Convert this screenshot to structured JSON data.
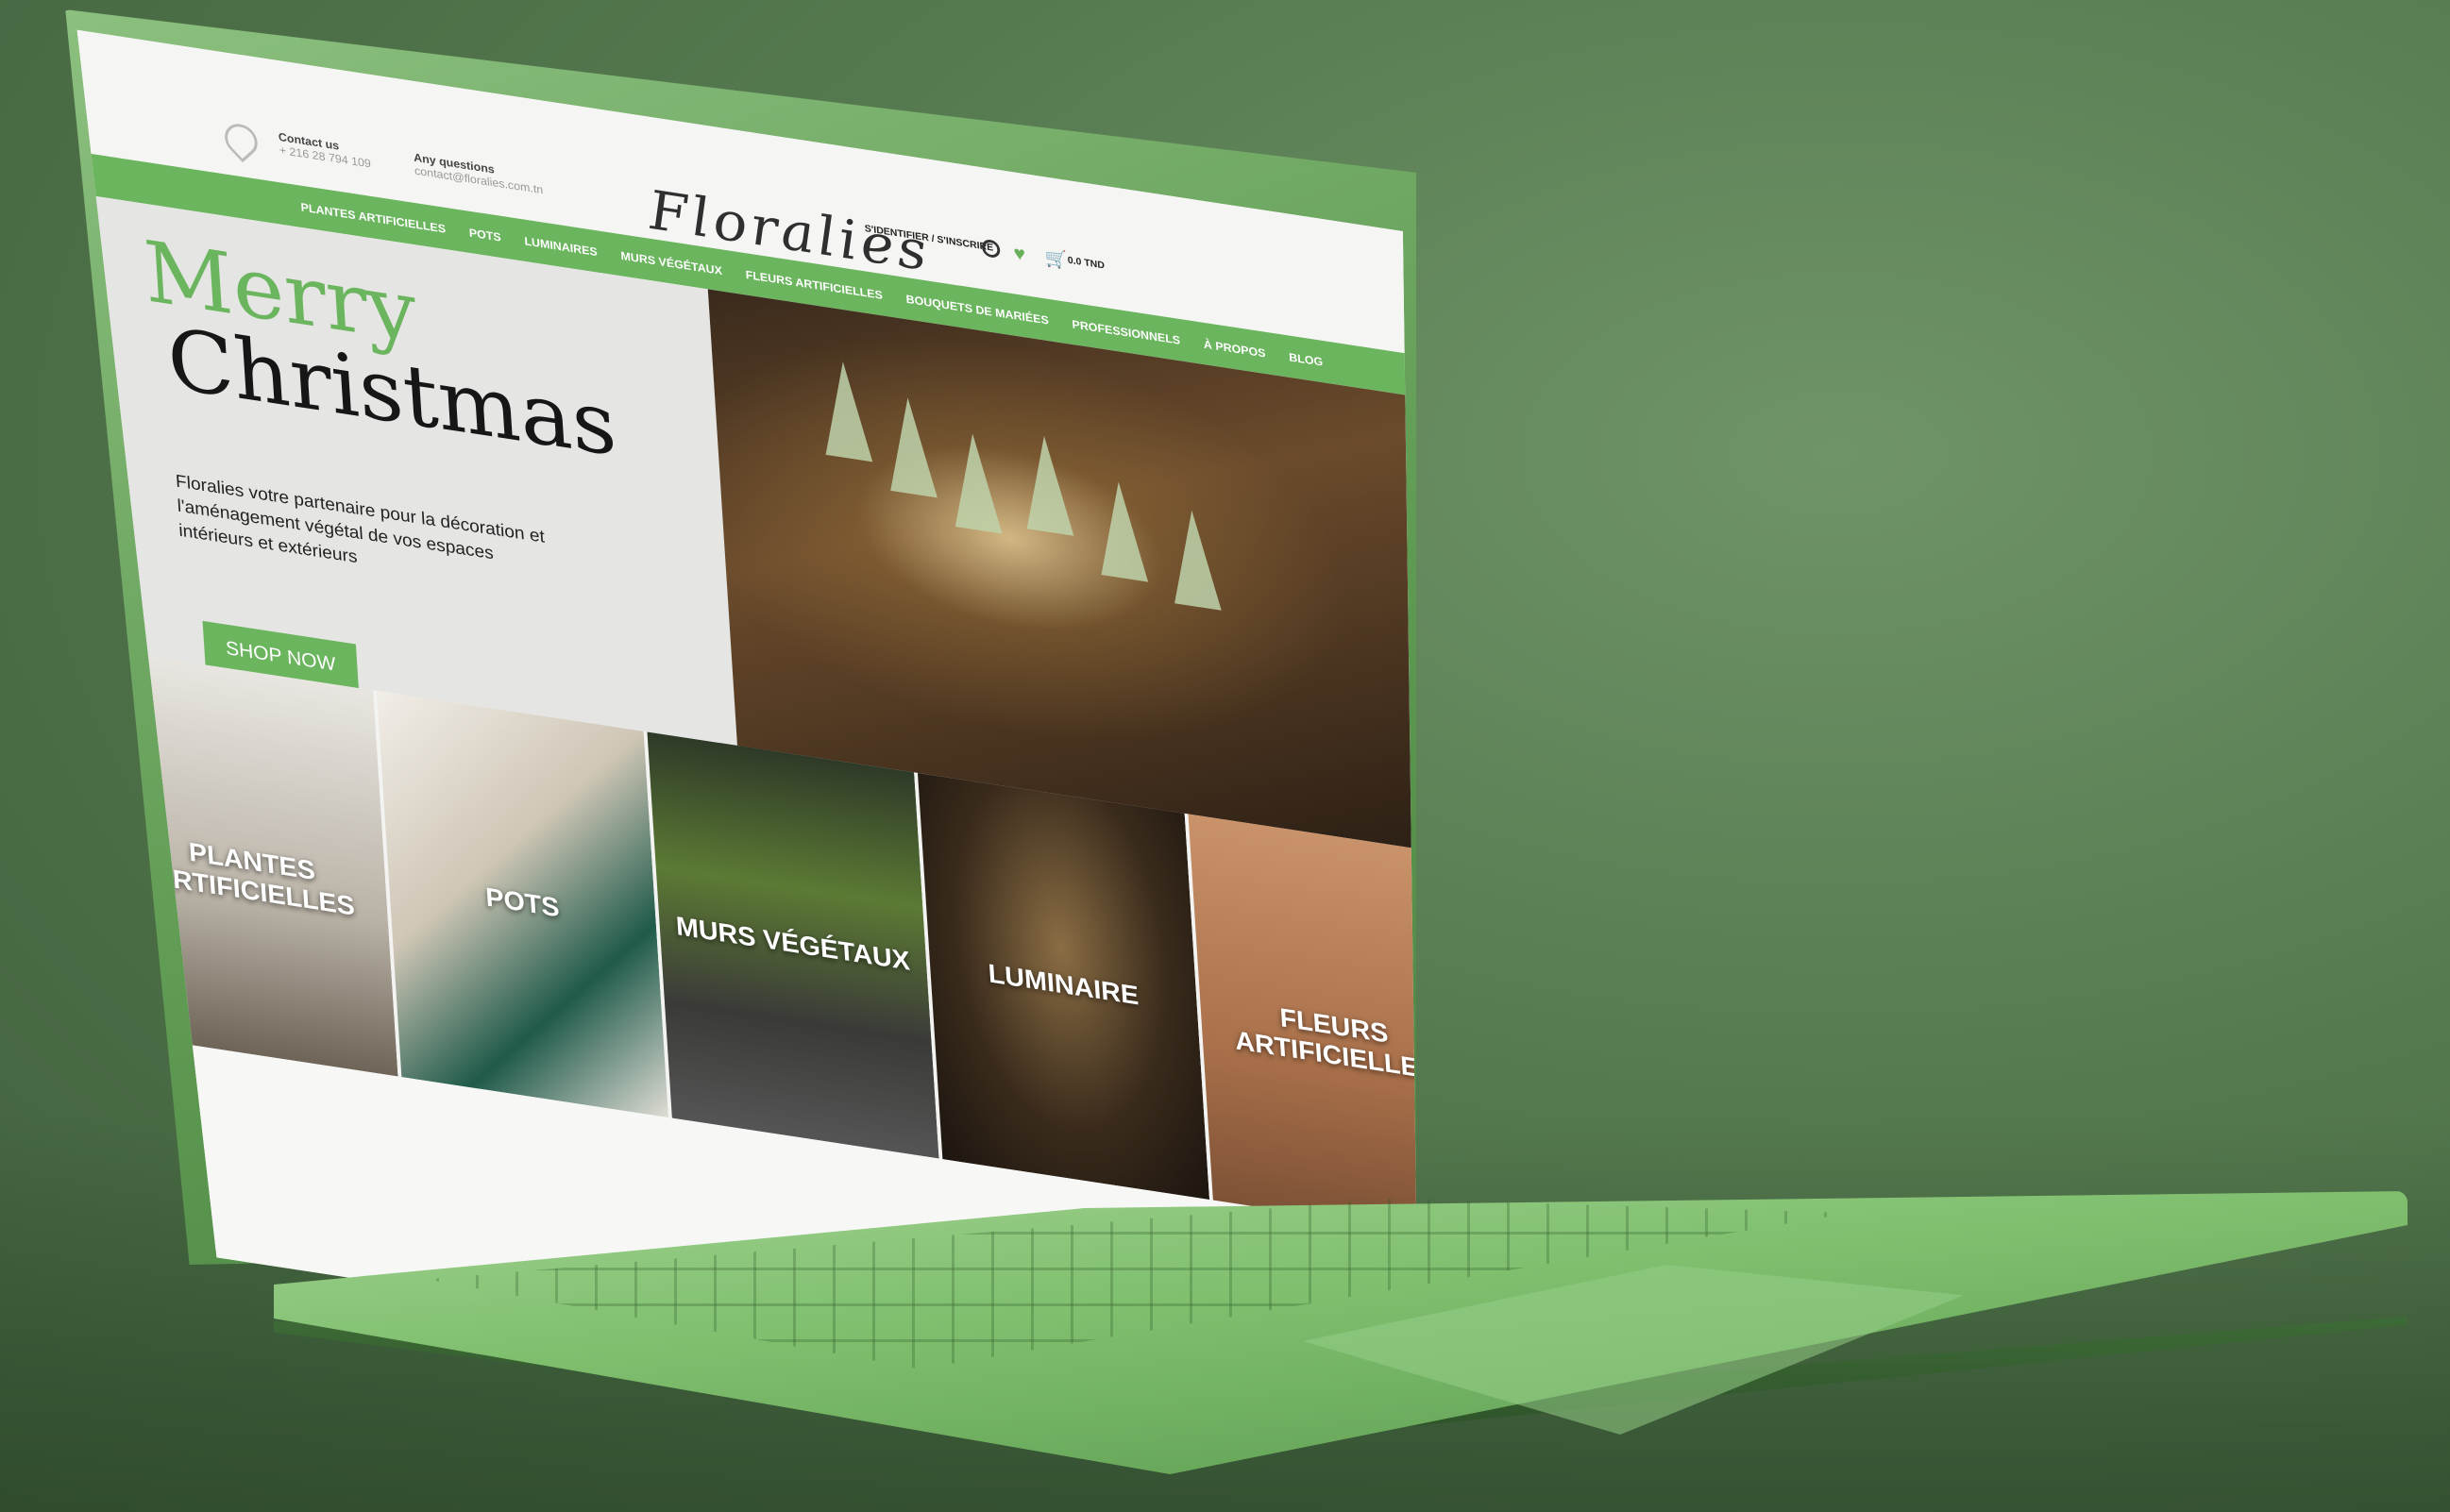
{
  "topbar": {
    "contact_label": "Contact us",
    "contact_value": "+ 216 28 794 109",
    "questions_label": "Any questions",
    "questions_value": "contact@floralies.com.tn",
    "logo": "Floralies",
    "account": "S'IDENTIFIER / S'INSCRIRE",
    "cart_total": "0.0 TND"
  },
  "nav": {
    "items": [
      "PLANTES ARTIFICIELLES",
      "POTS",
      "LUMINAIRES",
      "MURS VÉGÉTAUX",
      "FLEURS ARTIFICIELLES",
      "BOUQUETS DE MARIÉES",
      "PROFESSIONNELS",
      "À PROPOS",
      "BLOG"
    ]
  },
  "hero": {
    "merry": "Merry",
    "christmas": "Christmas",
    "description": "Floralies votre partenaire pour la décoration et l'aménagement végétal de vos espaces intérieurs et extérieurs",
    "cta": "SHOP NOW"
  },
  "categories": [
    "PLANTES ARTIFICIELLES",
    "POTS",
    "MURS VÉGÉTAUX",
    "LUMINAIRE",
    "FLEURS ARTIFICIELLES"
  ],
  "colors": {
    "accent": "#6bb55e",
    "background": "#55794f"
  }
}
